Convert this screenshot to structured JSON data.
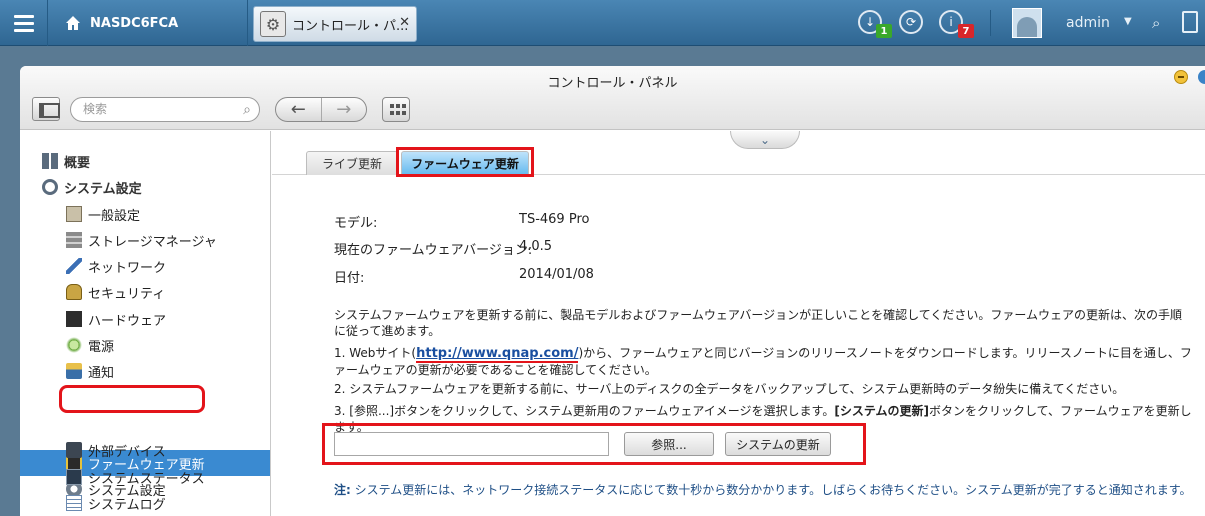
{
  "topbar": {
    "device_name": "NASDC6FCA",
    "open_tab_label": "コントロール・パ...",
    "open_tab_close": "✕",
    "download_badge": "1",
    "info_badge": "7",
    "user_name": "admin",
    "user_caret": "▼",
    "search_glyph": "⌕",
    "icons": [
      "menu-icon",
      "home-icon",
      "gear-icon",
      "download-icon",
      "sync-icon",
      "info-icon",
      "avatar-icon",
      "search-icon",
      "document-icon"
    ],
    "colors": {
      "badge_green": "#3aa82a",
      "badge_red": "#d8262b",
      "bar": "#3a76a4"
    }
  },
  "window": {
    "title": "コントロール・パネル",
    "search_placeholder": "検索",
    "search_glyph": "⌕",
    "back_glyph": "←",
    "forward_glyph": "→",
    "handle_glyph": "⌄"
  },
  "sidebar": {
    "sections": [
      {
        "label": "概要",
        "icon": "overview-icon"
      },
      {
        "label": "システム設定",
        "icon": "system-gear-icon"
      }
    ],
    "items": [
      {
        "label": "一般設定",
        "icon": "general-settings-icon"
      },
      {
        "label": "ストレージマネージャ",
        "icon": "storage-icon"
      },
      {
        "label": "ネットワーク",
        "icon": "network-icon"
      },
      {
        "label": "セキュリティ",
        "icon": "lock-icon"
      },
      {
        "label": "ハードウェア",
        "icon": "hardware-icon"
      },
      {
        "label": "電源",
        "icon": "power-icon"
      },
      {
        "label": "通知",
        "icon": "notification-icon"
      },
      {
        "label": "ファームウェア更新",
        "icon": "firmware-icon",
        "active": true
      },
      {
        "label": "システム設定",
        "icon": "backup-icon"
      },
      {
        "label": "外部デバイス",
        "icon": "external-device-icon"
      },
      {
        "label": "システムステータス",
        "icon": "status-monitor-icon"
      },
      {
        "label": "システムログ",
        "icon": "log-icon"
      }
    ],
    "active_color": "#3a8ad1"
  },
  "tabs": [
    {
      "label": "ライブ更新",
      "active": false
    },
    {
      "label": "ファームウェア更新",
      "active": true
    }
  ],
  "firmware": {
    "model_label": "モデル:",
    "model_value": "TS-469 Pro",
    "version_label": "現在のファームウェアバージョン:",
    "version_value": "4.0.5",
    "date_label": "日付:",
    "date_value": "2014/01/08",
    "intro": "システムファームウェアを更新する前に、製品モデルおよびファームウェアバージョンが正しいことを確認してください。ファームウェアの更新は、次の手順に従って進めます。",
    "step1_prefix": "1. Webサイト(",
    "step1_link": "http://www.qnap.com/",
    "step1_suffix": ")から、ファームウェアと同じバージョンのリリースノートをダウンロードします。リリースノートに目を通し、ファームウェアの更新が必要であることを確認してください。",
    "step2": "2. システムファームウェアを更新する前に、サーバ上のディスクの全データをバックアップして、システム更新時のデータ紛失に備えてください。",
    "step3_a": "3. [参照...]ボタンをクリックして、システム更新用のファームウェアイメージを選択します。",
    "step3_b": "[システムの更新]",
    "step3_c": "ボタンをクリックして、ファームウェアを更新します。",
    "file_path_value": "",
    "browse_label": "参照...",
    "update_label": "システムの更新",
    "note_label": "注:",
    "note_text": " システム更新には、ネットワーク接続ステータスに応じて数十秒から数分かかります。しばらくお待ちください。システム更新が完了すると通知されます。"
  },
  "highlight_color": "#e3141a"
}
